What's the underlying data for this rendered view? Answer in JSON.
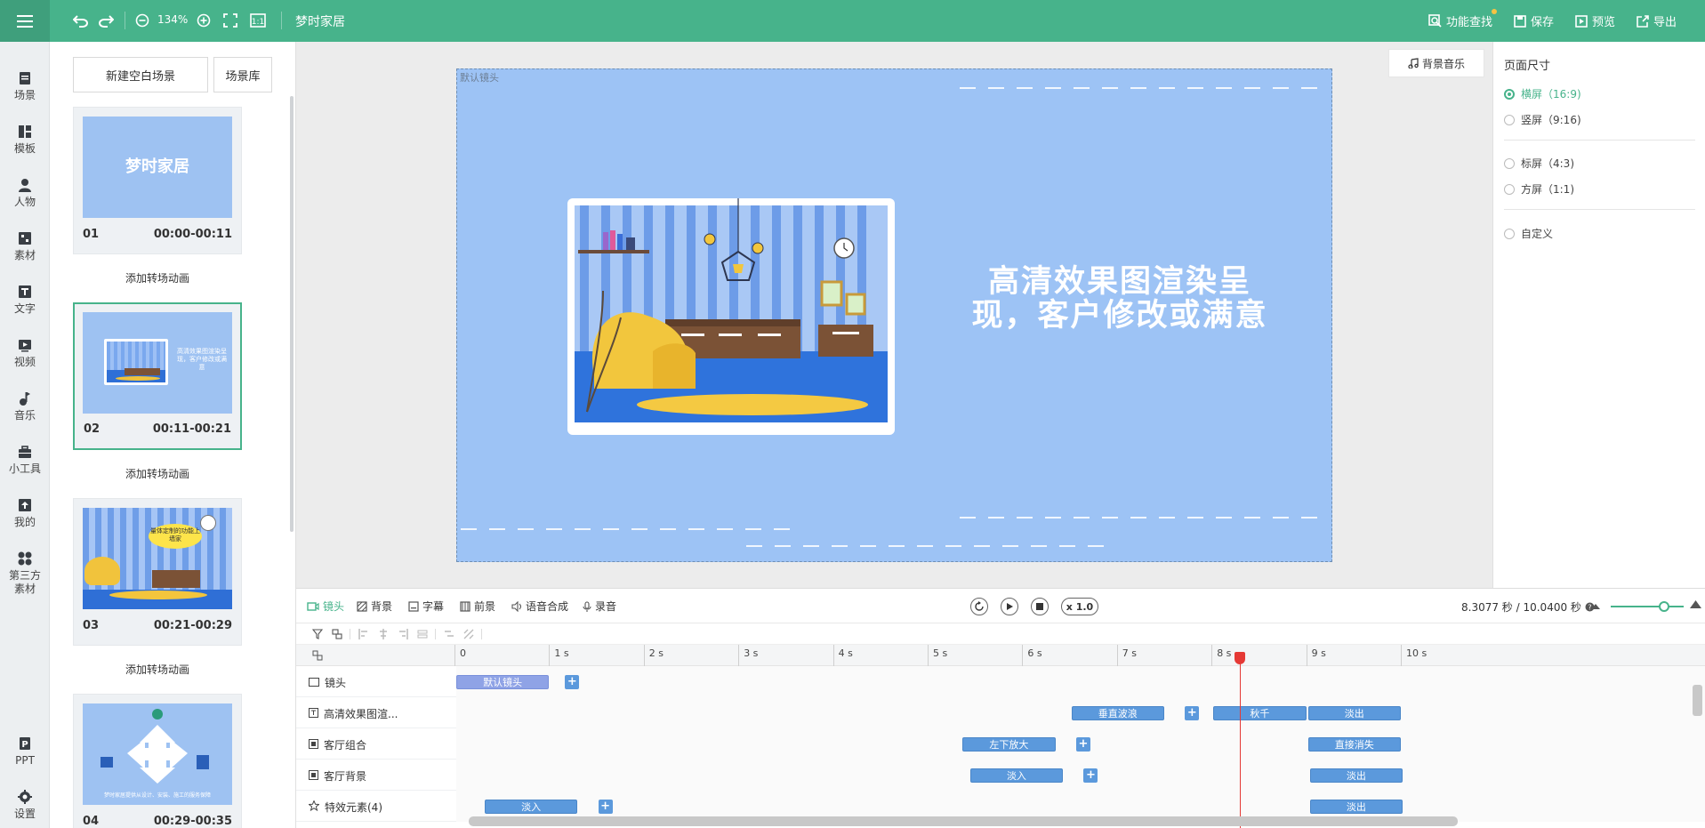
{
  "topbar": {
    "zoom": "134%",
    "project_title": "梦时家居",
    "find": "功能查找",
    "save": "保存",
    "preview": "预览",
    "export": "导出"
  },
  "rail": [
    {
      "label": "场景",
      "icon": "scene-icon"
    },
    {
      "label": "模板",
      "icon": "template-icon"
    },
    {
      "label": "人物",
      "icon": "person-icon"
    },
    {
      "label": "素材",
      "icon": "material-icon"
    },
    {
      "label": "文字",
      "icon": "text-icon"
    },
    {
      "label": "视频",
      "icon": "video-icon"
    },
    {
      "label": "音乐",
      "icon": "music-icon"
    },
    {
      "label": "小工具",
      "icon": "toolbox-icon"
    },
    {
      "label": "我的",
      "icon": "upload-icon"
    },
    {
      "label": "第三方",
      "label2": "素材",
      "icon": "third-party-icon"
    },
    {
      "label": "PPT",
      "icon": "ppt-icon"
    },
    {
      "label": "设置",
      "icon": "gear-icon"
    }
  ],
  "scenes": {
    "new_blank": "新建空白场景",
    "library": "场景库",
    "add_transition": "添加转场动画",
    "items": [
      {
        "num": "01",
        "time": "00:00-00:11",
        "thumb_text": "梦时家居"
      },
      {
        "num": "02",
        "time": "00:11-00:21",
        "thumb_text": "高清效果图渲染呈现，客户修改或满意"
      },
      {
        "num": "03",
        "time": "00:21-00:29",
        "thumb_text": "量体定制的功能上墙家"
      },
      {
        "num": "04",
        "time": "00:29-00:35",
        "thumb_text": "梦时家居提供从设计、安装、施工的服务保障"
      }
    ]
  },
  "stage": {
    "label": "默认镜头",
    "text_line1": "高清效果图渲染呈",
    "text_line2": "现，客户修改或满意",
    "bgm": "背景音乐"
  },
  "page_size": {
    "title": "页面尺寸",
    "options": [
      {
        "label": "横屏（16:9)",
        "selected": true
      },
      {
        "label": "竖屏（9:16)",
        "selected": false
      },
      {
        "label": "标屏（4:3)",
        "selected": false
      },
      {
        "label": "方屏（1:1)",
        "selected": false
      },
      {
        "label": "自定义",
        "selected": false
      }
    ]
  },
  "timeline": {
    "tabs": [
      "镜头",
      "背景",
      "字幕",
      "前景",
      "语音合成",
      "录音"
    ],
    "speed": "x 1.0",
    "timecode": "8.3077 秒 / 10.0400 秒",
    "ruler": [
      "0",
      "1 s",
      "2 s",
      "3 s",
      "4 s",
      "5 s",
      "6 s",
      "7 s",
      "8 s",
      "9 s",
      "10 s"
    ],
    "playhead_time": 8.3077,
    "duration": 10.04,
    "tracks": [
      {
        "name": "镜头",
        "clips": [
          {
            "label": "默认镜头",
            "start": 0,
            "end": 1,
            "kind": "cam"
          }
        ],
        "plus_at": 1.15
      },
      {
        "name": "高清效果图渲...",
        "clips": [
          {
            "label": "垂直波浪",
            "start": 6.5,
            "end": 7.5
          },
          {
            "label": "秋千",
            "start": 8.0,
            "end": 9.0
          },
          {
            "label": "淡出",
            "start": 9.0,
            "end": 10.0
          }
        ],
        "plus_at": 7.7
      },
      {
        "name": "客厅组合",
        "clips": [
          {
            "label": "左下放大",
            "start": 5.35,
            "end": 6.35
          },
          {
            "label": "直接消失",
            "start": 9.0,
            "end": 10.0
          }
        ],
        "plus_at": 6.55
      },
      {
        "name": "客厅背景",
        "clips": [
          {
            "label": "淡入",
            "start": 5.43,
            "end": 6.43
          },
          {
            "label": "淡出",
            "start": 9.02,
            "end": 10.02
          }
        ],
        "plus_at": 6.63
      },
      {
        "name": "特效元素(4)",
        "clips": [
          {
            "label": "淡入",
            "start": 0.3,
            "end": 1.3
          },
          {
            "label": "淡出",
            "start": 9.02,
            "end": 10.02
          }
        ],
        "plus_at": 1.5
      }
    ]
  }
}
